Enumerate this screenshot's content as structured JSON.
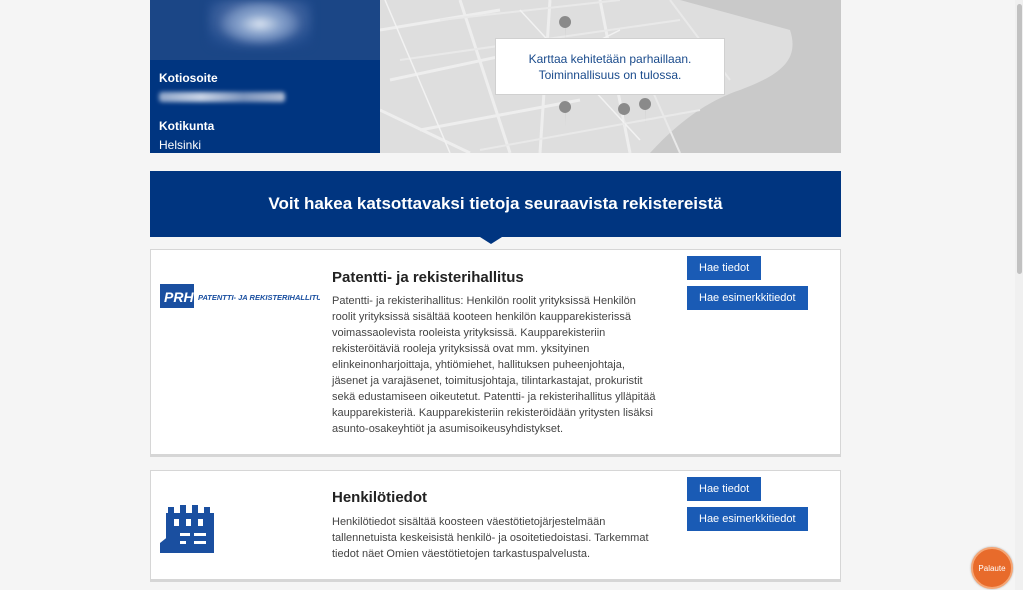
{
  "profile": {
    "home_address_label": "Kotiosoite",
    "home_municipality_label": "Kotikunta",
    "home_municipality_value": "Helsinki"
  },
  "map": {
    "notice_line1": "Karttaa kehitetään parhaillaan.",
    "notice_line2": "Toiminnallisuus on tulossa."
  },
  "banner": {
    "title": "Voit hakea katsottavaksi tietoja seuraavista rekistereistä"
  },
  "registers": [
    {
      "logo_text": "PRH",
      "logo_subtext": "PATENTTI- JA REKISTERIHALLITUS",
      "title": "Patentti- ja rekisterihallitus",
      "description": "Patentti- ja rekisterihallitus: Henkilön roolit yrityksissä Henkilön roolit yrityksissä sisältää kooteen henkilön kaupparekisterissä voimassaolevista rooleista yrityksissä. Kaupparekisteriin rekisteröitäviä rooleja yrityksissä ovat mm. yksityinen elinkeinonharjoittaja, yhtiömiehet, hallituksen puheenjohtaja, jäsenet ja varajäsenet, toimitusjohtaja, tilintarkastajat, prokuristit sekä edustamiseen oikeutetut. Patentti- ja rekisterihallitus ylläpitää kaupparekisteriä. Kaupparekisteriin rekisteröidään yritysten lisäksi asunto-osakeyhtiöt ja asumisoikeusyhdistykset.",
      "fetch_label": "Hae tiedot",
      "sample_label": "Hae esimerkkitiedot"
    },
    {
      "title": "Henkilötiedot",
      "description": "Henkilötiedot sisältää koosteen väestötietojärjestelmään tallennetuista keskeisistä henkilö- ja osoitetiedoistasi. Tarkemmat tiedot näet Omien väestötietojen tarkastuspalvelusta.",
      "fetch_label": "Hae tiedot",
      "sample_label": "Hae esimerkkitiedot"
    }
  ],
  "feedback": {
    "label": "Palaute"
  },
  "colors": {
    "brand_dark": "#003580",
    "button": "#1a5bb5",
    "feedback": "#e86b2b"
  }
}
